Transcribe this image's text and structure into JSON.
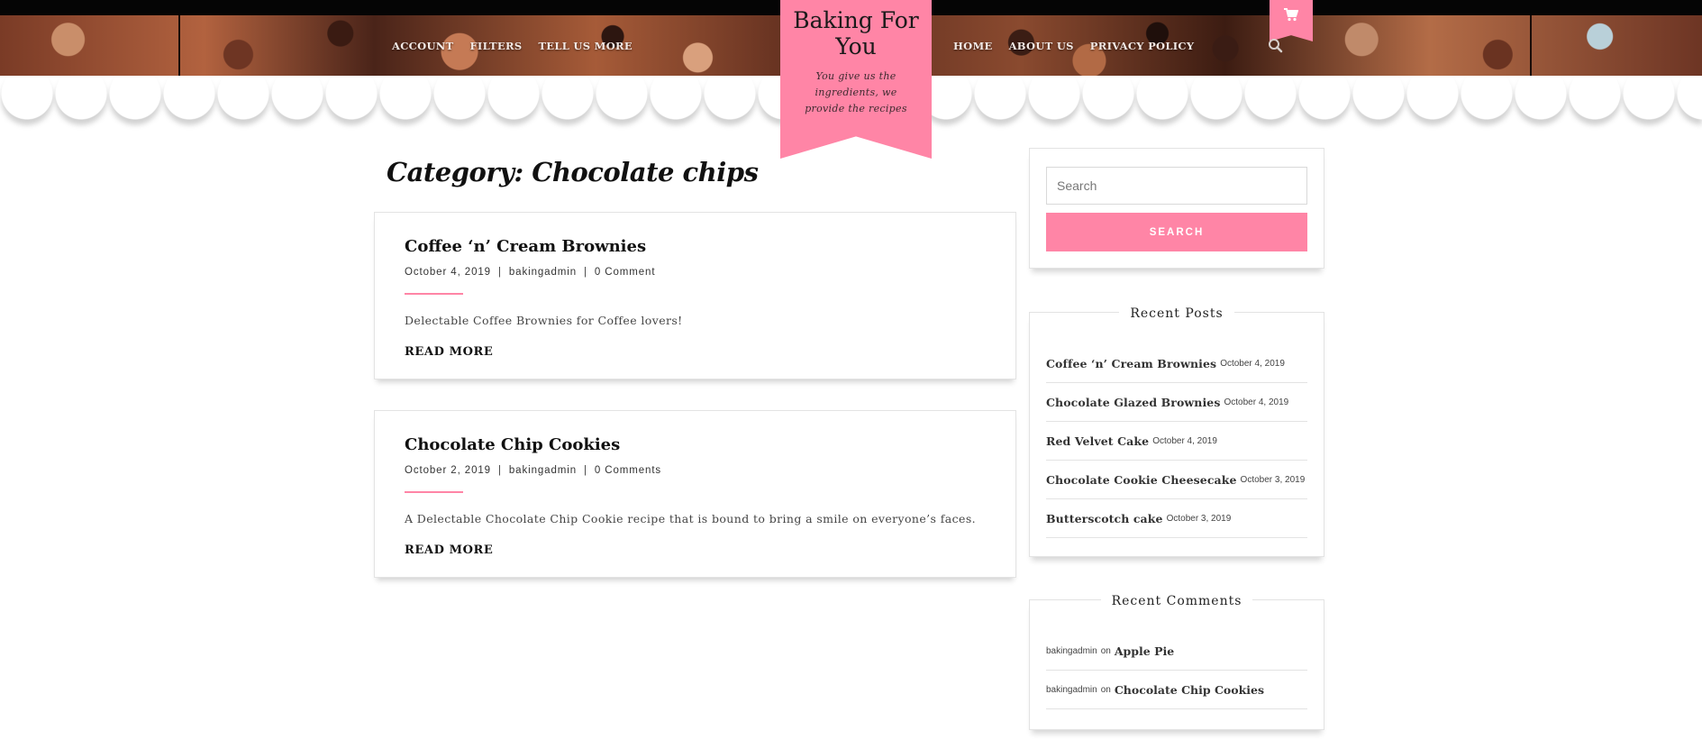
{
  "header": {
    "site_title": "Baking For You",
    "tagline": "You give us the ingredients, we provide the recipes",
    "nav_left": [
      "ACCOUNT",
      "FILTERS",
      "TELL US MORE"
    ],
    "nav_right": [
      "HOME",
      "ABOUT US",
      "PRIVACY POLICY"
    ],
    "accent_color": "#ff85a6",
    "cart_icon": "cart-icon",
    "search_icon": "search-icon"
  },
  "main": {
    "page_title": "Category: Chocolate chips",
    "posts": [
      {
        "title": "Coffee ‘n’ Cream Brownies",
        "date": "October 4, 2019",
        "author": "bakingadmin",
        "comments": "0 Comment",
        "excerpt": "Delectable Coffee Brownies for Coffee lovers!",
        "read_more": "READ MORE"
      },
      {
        "title": "Chocolate Chip Cookies",
        "date": "October 2, 2019",
        "author": "bakingadmin",
        "comments": "0 Comments",
        "excerpt": "A Delectable Chocolate Chip Cookie recipe that is bound to bring a smile on everyone’s faces.",
        "read_more": "READ MORE"
      }
    ]
  },
  "sidebar": {
    "search": {
      "placeholder": "Search",
      "button_label": "SEARCH"
    },
    "recent_posts": {
      "title": "Recent Posts",
      "items": [
        {
          "title": "Coffee ‘n’ Cream Brownies",
          "date": "October 4, 2019"
        },
        {
          "title": "Chocolate Glazed Brownies",
          "date": "October 4, 2019"
        },
        {
          "title": "Red Velvet Cake",
          "date": "October 4, 2019"
        },
        {
          "title": "Chocolate Cookie Cheesecake",
          "date": "October 3, 2019"
        },
        {
          "title": "Butterscotch cake",
          "date": "October 3, 2019"
        }
      ]
    },
    "recent_comments": {
      "title": "Recent Comments",
      "on_text": "on",
      "items": [
        {
          "author": "bakingadmin",
          "post": "Apple Pie"
        },
        {
          "author": "bakingadmin",
          "post": "Chocolate Chip Cookies"
        }
      ]
    }
  }
}
